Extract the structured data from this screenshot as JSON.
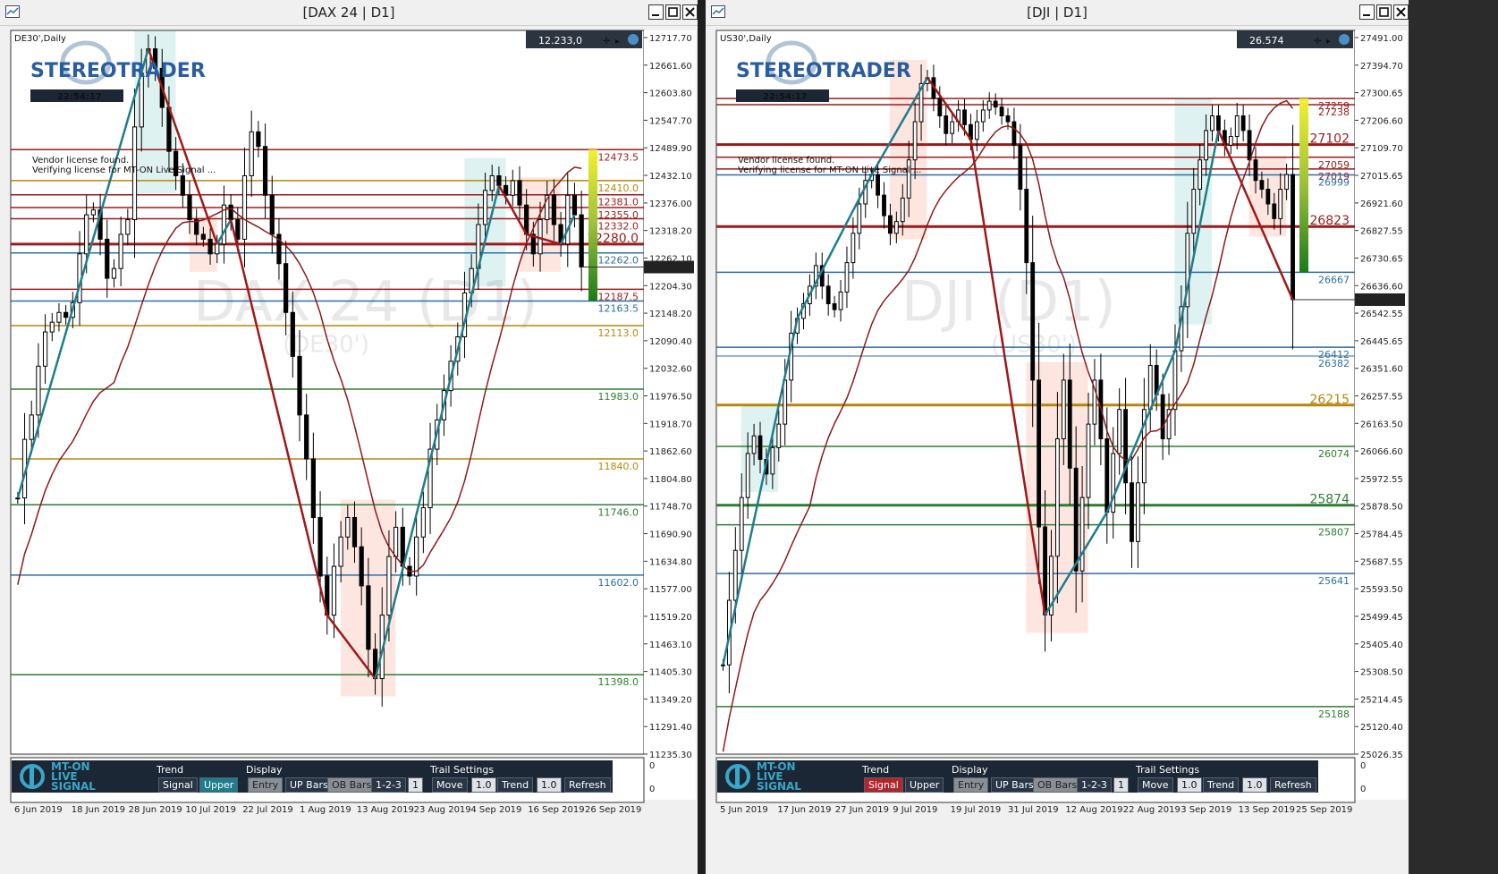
{
  "windows": [
    {
      "id": "dax",
      "title": "[DAX 24 | D1]",
      "symbol_label": "DE30',Daily",
      "watermark": "DAX 24 (D1)",
      "watermark_sub": "(DE30')",
      "price_box": "12.233,0",
      "clock": "22:54:17",
      "vendor_line1": "Vendor license found.",
      "vendor_line2": "Verifying license for MT-ON Live Signal ...",
      "current_price_tag": "12232.95",
      "chart_data": {
        "type": "candlestick",
        "title": "[DAX 24 | D1]",
        "ylim": [
          11235.3,
          12717.7
        ],
        "y_ticks": [
          "12717.70",
          "12661.60",
          "12603.80",
          "12547.70",
          "12489.90",
          "12432.10",
          "12376.00",
          "12318.20",
          "12262.10",
          "12204.30",
          "12148.20",
          "12090.40",
          "12032.60",
          "11976.50",
          "11918.70",
          "11862.60",
          "11804.80",
          "11748.70",
          "11690.90",
          "11634.80",
          "11577.00",
          "11519.20",
          "11463.10",
          "11405.30",
          "11349.20",
          "11291.40",
          "11235.30"
        ],
        "x_ticks": [
          "6 Jun 2019",
          "18 Jun 2019",
          "28 Jun 2019",
          "10 Jul 2019",
          "22 Jul 2019",
          "1 Aug 2019",
          "13 Aug 2019",
          "23 Aug 2019",
          "4 Sep 2019",
          "16 Sep 2019",
          "26 Sep 2019"
        ],
        "subwindow_ticks": [
          "0",
          "0"
        ],
        "levels": [
          {
            "value": 12473.5,
            "label": "12473.5",
            "color": "#9b1b1b",
            "size": "normal"
          },
          {
            "value": 12410.0,
            "label": "12410.0",
            "color": "#b8860b",
            "size": "normal"
          },
          {
            "value": 12381.0,
            "label": "12381.0",
            "color": "#9b1b1b",
            "size": "normal"
          },
          {
            "value": 12355.0,
            "label": "12355.0",
            "color": "#9b1b1b",
            "size": "normal"
          },
          {
            "value": 12332.0,
            "label": "12332.0",
            "color": "#9b1b1b",
            "size": "normal"
          },
          {
            "value": 12280.0,
            "label": "12280.0",
            "color": "#9b1b1b",
            "size": "big"
          },
          {
            "value": 12262.0,
            "label": "12262.0",
            "color": "#2e6da4",
            "size": "normal"
          },
          {
            "value": 12187.5,
            "label": "12187.5",
            "color": "#9b1b1b",
            "size": "normal"
          },
          {
            "value": 12163.5,
            "label": "12163.5",
            "color": "#2e6da4",
            "size": "normal"
          },
          {
            "value": 12113.0,
            "label": "12113.0",
            "color": "#b8860b",
            "size": "normal"
          },
          {
            "value": 11983.0,
            "label": "11983.0",
            "color": "#2e7d32",
            "size": "normal"
          },
          {
            "value": 11840.0,
            "label": "11840.0",
            "color": "#b8860b",
            "size": "normal"
          },
          {
            "value": 11746.0,
            "label": "11746.0",
            "color": "#2e7d32",
            "size": "normal"
          },
          {
            "value": 11602.0,
            "label": "11602.0",
            "color": "#2e6da4",
            "size": "normal"
          },
          {
            "value": 11398.0,
            "label": "11398.0",
            "color": "#2e7d32",
            "size": "normal"
          }
        ],
        "closes": [
          11760,
          11880,
          11930,
          12030,
          12100,
          12120,
          12140,
          12130,
          12160,
          12260,
          12340,
          12350,
          12290,
          12210,
          12230,
          12300,
          12330,
          12520,
          12630,
          12680,
          12640,
          12560,
          12470,
          12420,
          12380,
          12330,
          12300,
          12290,
          12260,
          12280,
          12360,
          12330,
          12290,
          12420,
          12510,
          12480,
          12380,
          12300,
          12240,
          12140,
          12050,
          11930,
          11840,
          11720,
          11600,
          11520,
          11620,
          11680,
          11720,
          11660,
          11580,
          11450,
          11390,
          11520,
          11640,
          11700,
          11620,
          11600,
          11680,
          11740,
          11860,
          11920,
          11980,
          12040,
          12090,
          12180,
          12230,
          12320,
          12390,
          12420,
          12400,
          12380,
          12410,
          12360,
          12300,
          12260,
          12330,
          12380,
          12320,
          12280,
          12380,
          12340,
          12233
        ],
        "ma_series": "200-period moving average (dark red)"
      },
      "panel": {
        "trend_title": "Trend",
        "signal": "Signal",
        "upper": "Upper",
        "display_title": "Display",
        "entry": "Entry",
        "up_bars": "UP Bars",
        "ob_bars": "OB Bars",
        "pattern": "1-2-3",
        "one": "1",
        "trail_title": "Trail Settings",
        "move": "Move",
        "move_val": "1.0",
        "trend": "Trend",
        "trend_val": "1.0",
        "refresh": "Refresh",
        "brand_line1": "MT-ON",
        "brand_line2": "LIVE",
        "brand_line3": "SIGNAL"
      },
      "logo_text": "STEREOTRADER"
    },
    {
      "id": "dji",
      "title": "[DJI | D1]",
      "symbol_label": "US30',Daily",
      "watermark": "DJI (D1)",
      "watermark_sub": "(US30')",
      "price_box": "26.574",
      "clock": "22:54:17",
      "vendor_line1": "Vendor license found.",
      "vendor_line2": "Verifying license for MT-ON Live Signal ...",
      "current_price_tag": "26573.50",
      "chart_data": {
        "type": "candlestick",
        "title": "[DJI | D1]",
        "ylim": [
          25026.0,
          27491.0
        ],
        "y_ticks": [
          "27491.00",
          "27394.70",
          "27300.65",
          "27206.60",
          "27109.70",
          "27015.65",
          "26921.60",
          "26827.55",
          "26730.65",
          "26636.60",
          "26542.55",
          "26445.65",
          "26351.60",
          "26257.55",
          "26163.50",
          "26066.60",
          "25972.55",
          "25878.50",
          "25784.45",
          "25687.55",
          "25593.50",
          "25499.45",
          "25405.40",
          "25308.50",
          "25214.45",
          "25120.40",
          "25026.35"
        ],
        "x_ticks": [
          "5 Jun 2019",
          "17 Jun 2019",
          "27 Jun 2019",
          "9 Jul 2019",
          "19 Jul 2019",
          "31 Jul 2019",
          "12 Aug 2019",
          "22 Aug 2019",
          "3 Sep 2019",
          "13 Sep 2019",
          "25 Sep 2019"
        ],
        "subwindow_ticks": [
          "0",
          "0"
        ],
        "levels": [
          {
            "value": 27259,
            "label": "27259",
            "color": "#9b1b1b",
            "size": "normal"
          },
          {
            "value": 27238,
            "label": "27238",
            "color": "#9b1b1b",
            "size": "normal"
          },
          {
            "value": 27102,
            "label": "27102",
            "color": "#9b1b1b",
            "size": "big"
          },
          {
            "value": 27059,
            "label": "27059",
            "color": "#9b1b1b",
            "size": "normal"
          },
          {
            "value": 27019,
            "label": "27019",
            "color": "#9b1b1b",
            "size": "normal"
          },
          {
            "value": 26999,
            "label": "26999",
            "color": "#2e6da4",
            "size": "normal"
          },
          {
            "value": 26823,
            "label": "26823",
            "color": "#9b1b1b",
            "size": "big"
          },
          {
            "value": 26667,
            "label": "26667",
            "color": "#2e6da4",
            "size": "normal"
          },
          {
            "value": 26412,
            "label": "26412",
            "color": "#2e6da4",
            "size": "normal"
          },
          {
            "value": 26382,
            "label": "26382",
            "color": "#2e6da4",
            "size": "tiny"
          },
          {
            "value": 26215,
            "label": "26215",
            "color": "#b8860b",
            "size": "big"
          },
          {
            "value": 26074,
            "label": "26074",
            "color": "#2e7d32",
            "size": "normal"
          },
          {
            "value": 25874,
            "label": "25874",
            "color": "#2e7d32",
            "size": "big"
          },
          {
            "value": 25807,
            "label": "25807",
            "color": "#2e7d32",
            "size": "normal"
          },
          {
            "value": 25641,
            "label": "25641",
            "color": "#2e6da4",
            "size": "normal"
          },
          {
            "value": 25188,
            "label": "25188",
            "color": "#2e7d32",
            "size": "normal"
          }
        ],
        "closes": [
          25330,
          25550,
          25720,
          25900,
          26050,
          26110,
          26030,
          25980,
          26070,
          26150,
          26300,
          26460,
          26510,
          26560,
          26620,
          26690,
          26620,
          26560,
          26540,
          26600,
          26700,
          26800,
          26900,
          26980,
          27000,
          26930,
          26860,
          26800,
          26840,
          26920,
          27050,
          27180,
          27310,
          27330,
          27260,
          27200,
          27140,
          27180,
          27220,
          27170,
          27120,
          27180,
          27220,
          27250,
          27230,
          27200,
          27180,
          27100,
          26950,
          26700,
          26300,
          25800,
          25500,
          25700,
          26100,
          26300,
          26000,
          25650,
          25900,
          26150,
          26300,
          26100,
          25850,
          26050,
          26200,
          25950,
          25750,
          25950,
          26200,
          26350,
          26250,
          26100,
          26200,
          26400,
          26550,
          26800,
          26950,
          27050,
          27150,
          27200,
          27150,
          27100,
          27130,
          27200,
          27150,
          27050,
          26980,
          26950,
          26900,
          26850,
          26950,
          27000,
          26574
        ],
        "ma_series": "200-period moving average (dark red)"
      },
      "panel": {
        "trend_title": "Trend",
        "signal": "Signal",
        "upper": "Upper",
        "display_title": "Display",
        "entry": "Entry",
        "up_bars": "UP Bars",
        "ob_bars": "OB Bars",
        "pattern": "1-2-3",
        "one": "1",
        "trail_title": "Trail Settings",
        "move": "Move",
        "move_val": "1.0",
        "trend": "Trend",
        "trend_val": "1.0",
        "refresh": "Refresh",
        "brand_line1": "MT-ON",
        "brand_line2": "LIVE",
        "brand_line3": "SIGNAL"
      },
      "logo_text": "STEREOTRADER"
    }
  ]
}
